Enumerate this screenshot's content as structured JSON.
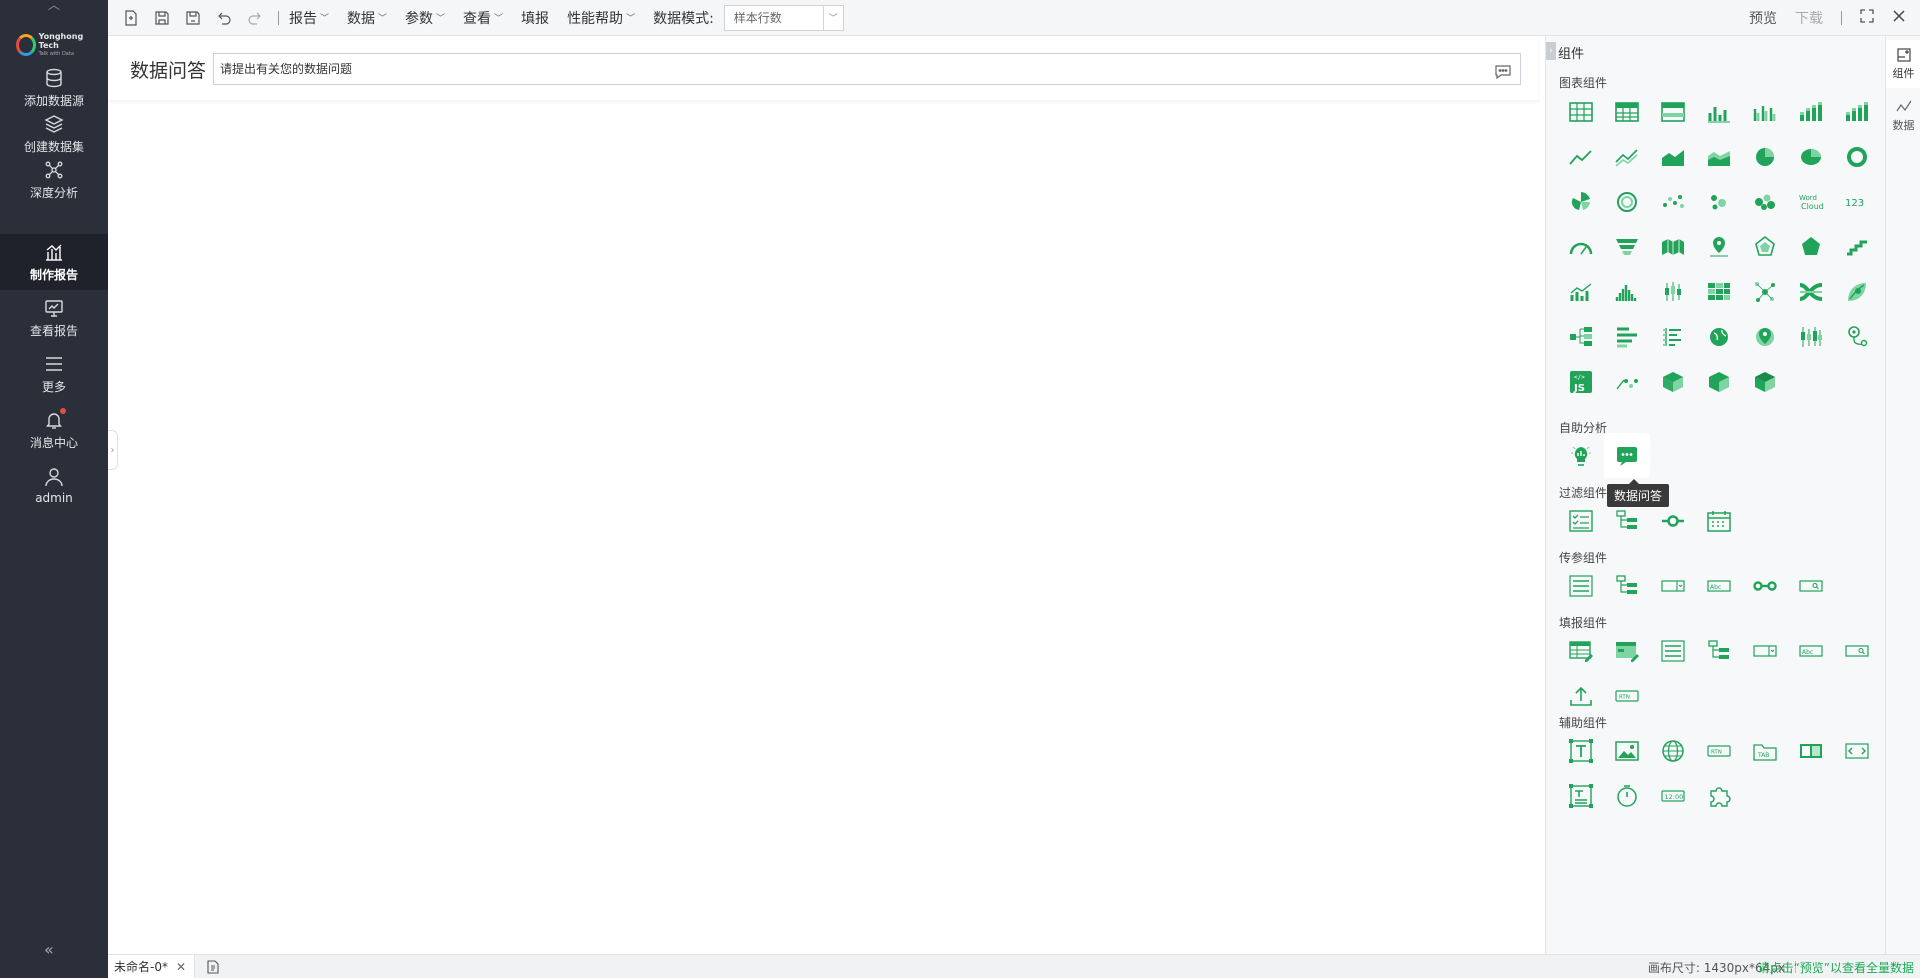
{
  "brand": {
    "name": "Yonghong Tech",
    "tagline": "Talk with Data"
  },
  "sidebar": {
    "items": [
      {
        "label": "添加数据源",
        "icon": "database-icon"
      },
      {
        "label": "创建数据集",
        "icon": "layers-icon"
      },
      {
        "label": "深度分析",
        "icon": "network-icon"
      },
      {
        "label": "制作报告",
        "icon": "bar-chart-icon",
        "active": true
      },
      {
        "label": "查看报告",
        "icon": "monitor-chart-icon"
      },
      {
        "label": "更多",
        "icon": "menu-icon"
      },
      {
        "label": "消息中心",
        "icon": "bell-icon"
      },
      {
        "label": "admin",
        "icon": "user-icon"
      }
    ]
  },
  "toolbar": {
    "menus": [
      "报告",
      "数据",
      "参数",
      "查看"
    ],
    "fill_report": "填报",
    "perf_help": "性能帮助",
    "data_mode_label": "数据模式:",
    "data_mode_value": "样本行数",
    "preview": "预览",
    "download": "下载"
  },
  "qa": {
    "title": "数据问答",
    "input_value": "请提出有关您的数据问题"
  },
  "panel": {
    "title": "组件",
    "sections": {
      "chart": "图表组件",
      "self_analysis": "自助分析",
      "filter": "过滤组件",
      "param": "传参组件",
      "fill": "填报组件",
      "aux": "辅助组件"
    },
    "tooltip": "数据问答",
    "tabs": [
      "组件",
      "数据"
    ]
  },
  "status": {
    "doc_tab": "未命名-0*",
    "canvas_size": "画布尺寸: 1430px*64px",
    "hint": "请点击“预览”以查看全量数据"
  },
  "colors": {
    "accent": "#1aaa55",
    "sidebar_bg": "#2b2f3a",
    "icon_green": "#22a35a"
  }
}
